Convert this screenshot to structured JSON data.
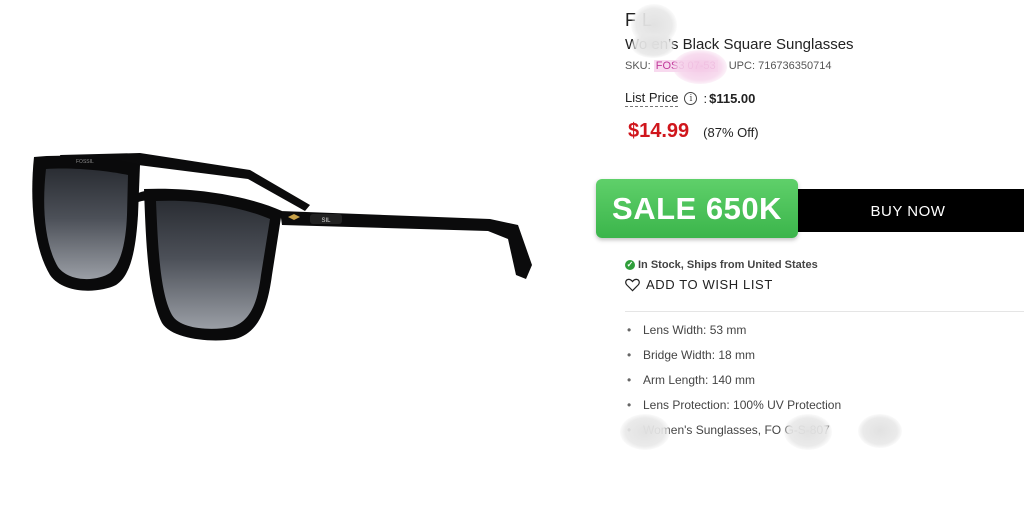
{
  "product": {
    "brand": "F   L",
    "title": "Wo  en's Black Square Sunglasses",
    "sku_label": "SKU:",
    "sku_value": "FOS3          07-53",
    "upc_label": "UPC:",
    "upc_value": "716736350714"
  },
  "pricing": {
    "list_price_label": "List Price",
    "list_price_separator": ":",
    "list_price_value": "$115.00",
    "sale_price": "$14.99",
    "discount": "(87% Off)"
  },
  "cta": {
    "sale_badge": "SALE 650K",
    "buy_now_label": "BUY NOW"
  },
  "availability": {
    "stock_text": "In Stock, Ships from United States",
    "wishlist_label": "ADD TO WISH LIST"
  },
  "specs": [
    {
      "text": "Lens Width: 53 mm"
    },
    {
      "text": "Bridge Width: 18 mm"
    },
    {
      "text": "Arm Length: 140 mm"
    },
    {
      "text": "Lens Protection: 100% UV Protection"
    },
    {
      "text": "Women's Sunglasses, FO          G-S-807"
    }
  ],
  "image": {
    "frame_logo_text": "FOSSIL",
    "temple_logo_text": "SIL"
  },
  "colors": {
    "sale_price": "#d0161c",
    "sale_badge": "#3bb54b",
    "buy_now_bg": "#000000",
    "in_stock": "#2f9e3a"
  },
  "icons": {
    "info": "info-icon",
    "stock": "check-circle-icon",
    "wishlist": "heart-icon"
  }
}
